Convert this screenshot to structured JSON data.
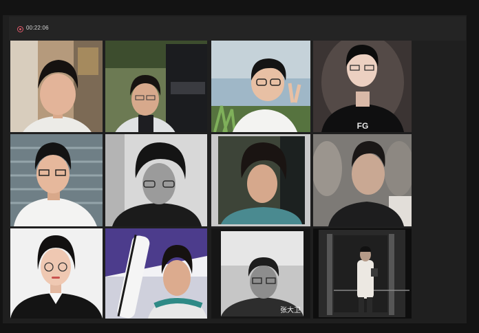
{
  "call": {
    "timer": "00:22:06",
    "record_color": "#e05a6b"
  },
  "participants": [
    {
      "id": "p1",
      "name_label": ""
    },
    {
      "id": "p2",
      "name_label": ""
    },
    {
      "id": "p3",
      "name_label": ""
    },
    {
      "id": "p4",
      "name_label": "",
      "shirt_text": "FG"
    },
    {
      "id": "p5",
      "name_label": ""
    },
    {
      "id": "p6",
      "name_label": ""
    },
    {
      "id": "p7",
      "name_label": ""
    },
    {
      "id": "p8",
      "name_label": ""
    },
    {
      "id": "p9",
      "name_label": ""
    },
    {
      "id": "p10",
      "name_label": ""
    },
    {
      "id": "p11",
      "name_label": "张大卫"
    },
    {
      "id": "p12",
      "name_label": ""
    }
  ]
}
